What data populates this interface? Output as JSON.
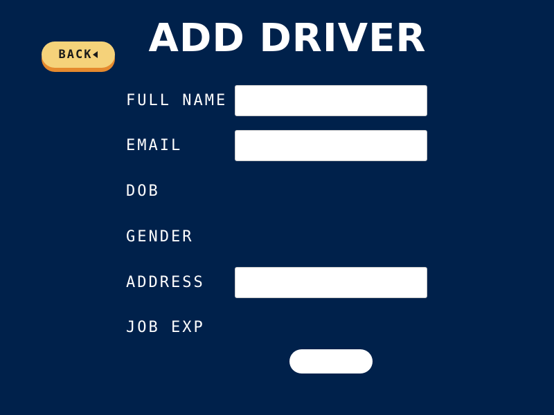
{
  "header": {
    "title": "ADD DRIVER",
    "back_label": "BACK"
  },
  "form": {
    "full_name": {
      "label": "FULL NAME",
      "value": "",
      "placeholder": ""
    },
    "email": {
      "label": "EMAIL",
      "value": "",
      "placeholder": ""
    },
    "dob": {
      "label": "DOB"
    },
    "gender": {
      "label": "GENDER"
    },
    "address": {
      "label": "ADDRESS",
      "value": "",
      "placeholder": ""
    },
    "job_exp": {
      "label": "JOB EXP"
    },
    "submit_label": ""
  },
  "colors": {
    "background": "#00214b",
    "back_button": "#f5d27a",
    "back_button_shadow": "#e58a2e",
    "text": "#ffffff"
  }
}
